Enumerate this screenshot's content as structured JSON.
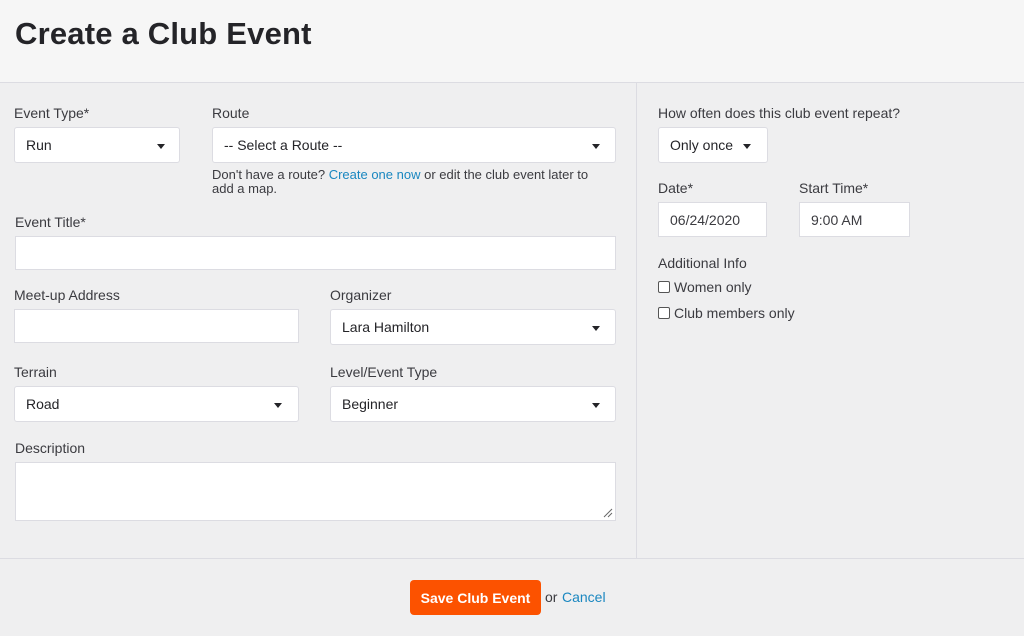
{
  "header": {
    "title": "Create a Club Event"
  },
  "form": {
    "event_type": {
      "label": "Event Type*",
      "value": "Run"
    },
    "route": {
      "label": "Route",
      "value": "-- Select a Route --",
      "help_prefix": "Don't have a route?",
      "help_link": "Create one now",
      "help_suffix": "or edit the club event later to add a map."
    },
    "event_title": {
      "label": "Event Title*",
      "value": ""
    },
    "meetup_address": {
      "label": "Meet-up Address",
      "value": ""
    },
    "organizer": {
      "label": "Organizer",
      "value": "Lara Hamilton"
    },
    "terrain": {
      "label": "Terrain",
      "value": "Road"
    },
    "level": {
      "label": "Level/Event Type",
      "value": "Beginner"
    },
    "description": {
      "label": "Description",
      "value": ""
    }
  },
  "schedule": {
    "repeat": {
      "label": "How often does this club event repeat?",
      "value": "Only once"
    },
    "date": {
      "label": "Date*",
      "value": "06/24/2020"
    },
    "start_time": {
      "label": "Start Time*",
      "value": "9:00 AM"
    },
    "additional_info": {
      "label": "Additional Info",
      "options": [
        {
          "label": "Women only",
          "checked": false
        },
        {
          "label": "Club members only",
          "checked": false
        }
      ]
    }
  },
  "footer": {
    "save_label": "Save Club Event",
    "or_text": "or",
    "cancel_label": "Cancel"
  },
  "colors": {
    "accent": "#fc5200",
    "link": "#1a87c0"
  }
}
